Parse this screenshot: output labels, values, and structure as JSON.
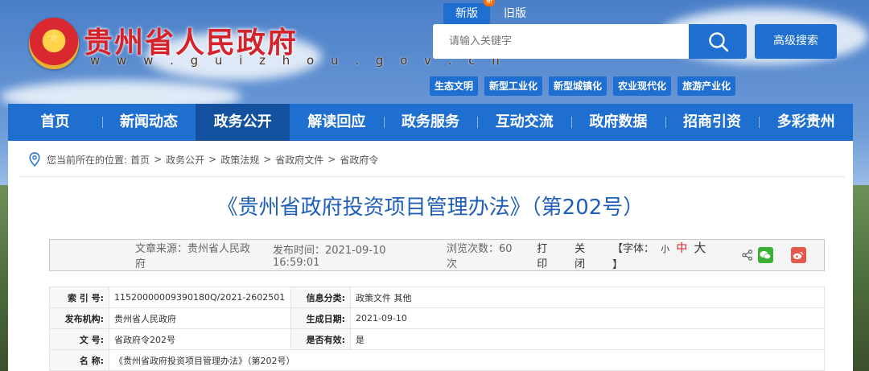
{
  "header": {
    "site_title": "贵州省人民政府",
    "site_url": "w w w . g u i z h o u . g o v . c n",
    "version_new": "新版",
    "version_new_badge": "新",
    "version_old": "旧版",
    "search_placeholder": "请输入关键字",
    "advanced_search": "高级搜索",
    "tags": [
      "生态文明",
      "新型工业化",
      "新型城镇化",
      "农业现代化",
      "旅游产业化"
    ]
  },
  "nav": {
    "items": [
      "首页",
      "新闻动态",
      "政务公开",
      "解读回应",
      "政务服务",
      "互动交流",
      "政府数据",
      "招商引资",
      "多彩贵州"
    ],
    "active_index": 2
  },
  "breadcrumb": {
    "prefix": "您当前所在的位置:",
    "items": [
      "首页",
      "政务公开",
      "政策法规",
      "省政府文件",
      "省政府令"
    ],
    "separator": ">"
  },
  "article": {
    "title": "《贵州省政府投资项目管理办法》（第202号）",
    "source": "文章来源：贵州省人民政府",
    "publish_time": "发布时间：2021-09-10 16:59:01",
    "views": "浏览次数：60次",
    "print": "打印",
    "close": "关闭",
    "font_label": "【字体：",
    "font_small": "小",
    "font_medium": "中",
    "font_large": "大",
    "font_end": "】"
  },
  "meta": {
    "rows": [
      {
        "k1": "索 引 号:",
        "v1": "11520000009390180Q/2021-2602501",
        "k2": "信息分类:",
        "v2": "政策文件    其他"
      },
      {
        "k1": "发布机构:",
        "v1": "贵州省人民政府",
        "k2": "生成日期:",
        "v2": "2021-09-10"
      },
      {
        "k1": "文      号:",
        "v1": "省政府令202号",
        "k2": "是否有效:",
        "v2": "是"
      },
      {
        "k1": "名      称:",
        "v1": "《贵州省政府投资项目管理办法》（第202号）"
      }
    ]
  }
}
